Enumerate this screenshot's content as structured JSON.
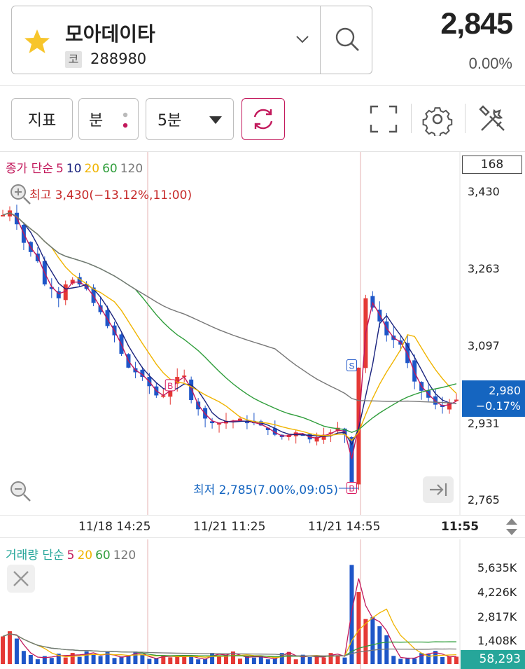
{
  "header": {
    "stock_name": "모아데이타",
    "code_badge": "코",
    "stock_code": "288980",
    "price": "2,845",
    "change_pct": "0.00%"
  },
  "toolbar": {
    "indicator_label": "지표",
    "unit_label": "분",
    "interval_label": "5분",
    "accent_color": "#c2185b"
  },
  "main_chart": {
    "legend_prefix": "종가 단순",
    "ma_labels": [
      "5",
      "10",
      "20",
      "60",
      "120"
    ],
    "ma_colors": [
      "#c2185b",
      "#1a237e",
      "#f0b400",
      "#2e9d3a",
      "#777777"
    ],
    "period_box": "168",
    "high_label": "최고 3,430(−13.12%,11:00)",
    "low_label": "최저 2,785(7.00%,09:05)",
    "y_ticks": [
      "3,430",
      "3,263",
      "3,097",
      "2,931",
      "2,765"
    ],
    "current_price": "2,980",
    "current_change": "−0.17%",
    "signal_marks": [
      "B",
      "S",
      "B"
    ]
  },
  "x_axis": {
    "labels": [
      "11/18 14:25",
      "11/21 11:25",
      "11/21 14:55",
      "11:55"
    ]
  },
  "volume_chart": {
    "legend_prefix": "거래량 단순",
    "ma_labels": [
      "5",
      "20",
      "60",
      "120"
    ],
    "ma_colors": [
      "#c2185b",
      "#f0b400",
      "#2e9d3a",
      "#777777"
    ],
    "y_ticks": [
      "5,635K",
      "4,226K",
      "2,817K",
      "1,408K"
    ],
    "current_volume": "58,293"
  },
  "chart_data": {
    "type": "candlestick",
    "interval": "5분",
    "y_range": [
      2765,
      3430
    ],
    "close_series": [
      3380,
      3390,
      3360,
      3320,
      3300,
      3280,
      3230,
      3220,
      3200,
      3230,
      3240,
      3230,
      3220,
      3190,
      3170,
      3140,
      3120,
      3080,
      3050,
      3040,
      3030,
      3010,
      2990,
      2990,
      3010,
      3030,
      3030,
      2980,
      2960,
      2940,
      2930,
      2930,
      2935,
      2935,
      2935,
      2933,
      2930,
      2925,
      2915,
      2905,
      2900,
      2905,
      2910,
      2905,
      2895,
      2900,
      2905,
      2910,
      2920,
      2905,
      2800,
      3050,
      3200,
      3180,
      3150,
      3120,
      3110,
      3100,
      3060,
      3020,
      3000,
      2985,
      2970,
      2965,
      2975,
      2980
    ],
    "high": 3430,
    "low": 2785,
    "last": 2980,
    "volume_ticks_k": [
      5635,
      4226,
      2817,
      1408
    ],
    "last_volume": 58293
  }
}
